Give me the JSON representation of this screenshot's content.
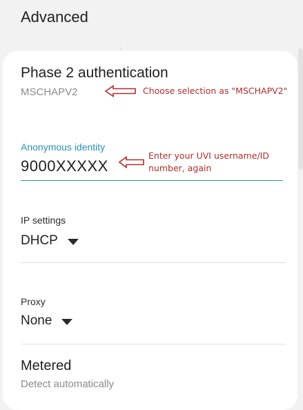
{
  "header": {
    "title": "Advanced"
  },
  "phase2": {
    "title": "Phase 2 authentication",
    "value": "MSCHAPV2",
    "annotation": "Choose selection as \"MSCHAPV2\""
  },
  "anonymous_identity": {
    "label": "Anonymous identity",
    "value": "9000XXXXX",
    "annotation_line1": "Enter your UVI username/ID",
    "annotation_line2": "number, again"
  },
  "ip_settings": {
    "label": "IP settings",
    "value": "DHCP"
  },
  "proxy": {
    "label": "Proxy",
    "value": "None"
  },
  "metered": {
    "title": "Metered",
    "value": "Detect automatically"
  },
  "colors": {
    "accent": "#2a8fb5",
    "annotation": "#b22a2a",
    "card": "#ffffff",
    "background": "#f2f2f2"
  },
  "icons": {
    "dropdown": "caret-down-icon",
    "annotation_arrow": "arrow-left-outline-icon"
  }
}
